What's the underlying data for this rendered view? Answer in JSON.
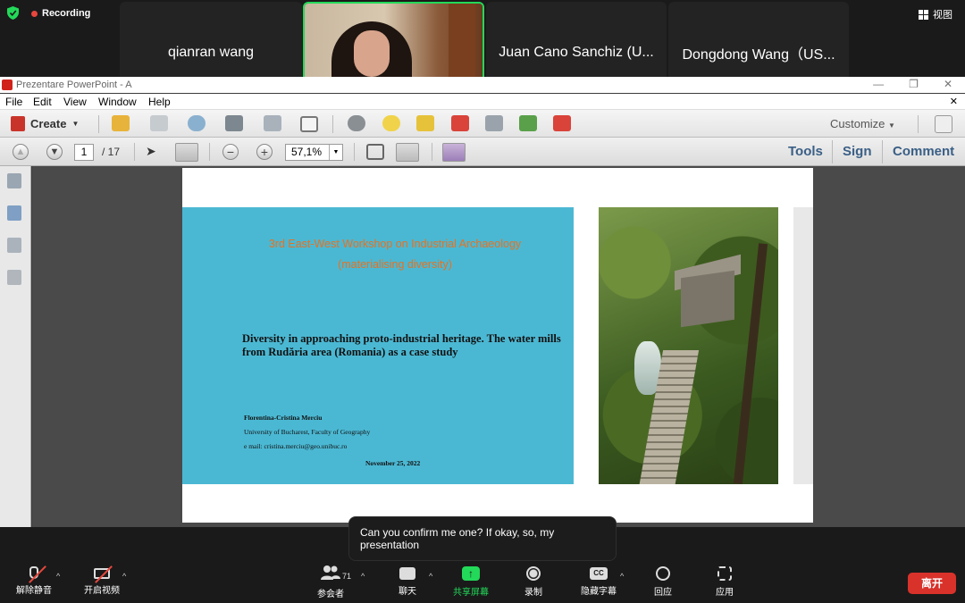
{
  "zoom": {
    "recording_label": "Recording",
    "view_label": "视图",
    "participants": [
      {
        "name": "qianran wang"
      },
      {
        "name": ""
      },
      {
        "name": "Juan Cano Sanchiz (U..."
      },
      {
        "name": "Dongdong Wang（US..."
      }
    ],
    "caption": "Can you confirm me one? If okay, so, my presentation",
    "controls": {
      "unmute": "解除静音",
      "start_video": "开启视频",
      "participants": "参会者",
      "participants_count": "71",
      "chat": "聊天",
      "share_screen": "共享屏幕",
      "record": "录制",
      "hide_captions": "隐藏字幕",
      "react": "回应",
      "apps": "应用",
      "leave": "离开",
      "cc_text": "CC"
    }
  },
  "acrobat": {
    "window_title": "Prezentare PowerPoint - A",
    "menu": {
      "file": "File",
      "edit": "Edit",
      "view": "View",
      "window": "Window",
      "help": "Help"
    },
    "toolbar": {
      "create": "Create",
      "customize": "Customize"
    },
    "nav": {
      "page_current": "1",
      "page_total": "/ 17",
      "zoom": "57,1%"
    },
    "right_tabs": {
      "tools": "Tools",
      "sign": "Sign",
      "comment": "Comment"
    }
  },
  "slide": {
    "workshop_line1": "3rd East-West Workshop on Industrial Archaeology",
    "workshop_line2": "(materialising diversity)",
    "title": "Diversity in approaching proto-industrial heritage. The water mills from Rudăria area (Romania) as a case study",
    "author": "Florentina-Cristina Merciu",
    "affiliation": "University of Bucharest, Faculty of Geography",
    "email": "e mail: cristina.merciu@geo.unibuc.ro",
    "date": "November 25, 2022"
  },
  "colors": {
    "zoom_bg": "#1a1a1a",
    "active_speaker": "#23d959",
    "slide_bg": "#4bb8d3",
    "workshop_text": "#e8711f",
    "leave_button": "#d8322b",
    "recording_dot": "#e8473d"
  }
}
